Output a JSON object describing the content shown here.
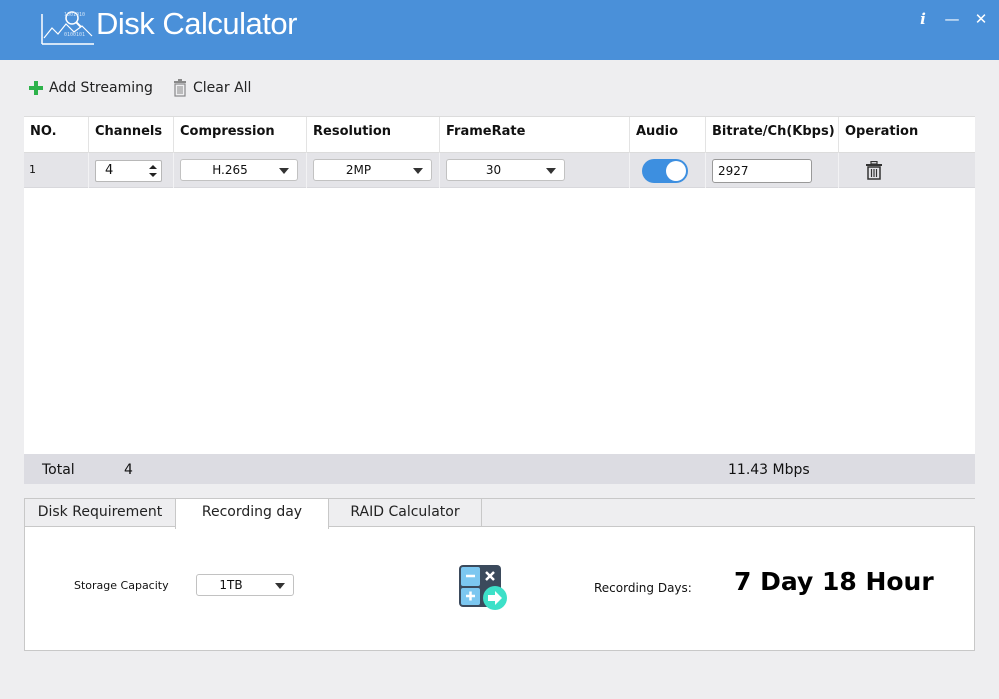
{
  "app": {
    "title_bold": "Disk",
    "title_rest": " Calculator"
  },
  "window_buttons": {
    "info": "i",
    "minimize": "—",
    "close": "✕"
  },
  "toolbar": {
    "add_label": "Add Streaming",
    "clear_label": "Clear All"
  },
  "table": {
    "headers": [
      "NO.",
      "Channels",
      "Compression",
      "Resolution",
      "FrameRate",
      "Audio",
      "Bitrate/Ch(Kbps)",
      "Operation"
    ],
    "rows": [
      {
        "no": "1",
        "channels": "4",
        "compression": "H.265",
        "resolution": "2MP",
        "framerate": "30",
        "audio_on": true,
        "bitrate": "2927"
      }
    ]
  },
  "total": {
    "label": "Total",
    "channels": "4",
    "bandwidth": "11.43 Mbps"
  },
  "tabs": [
    "Disk Requirement",
    "Recording day",
    "RAID Calculator"
  ],
  "active_tab": "Recording day",
  "recording": {
    "storage_label": "Storage Capacity",
    "storage_value": "1TB",
    "days_label": "Recording Days:",
    "days_value": "7 Day 18 Hour"
  },
  "colors": {
    "titlebar": "#4a90d9",
    "toggle_on": "#3d8fe0",
    "add_icon": "#2db24a"
  }
}
